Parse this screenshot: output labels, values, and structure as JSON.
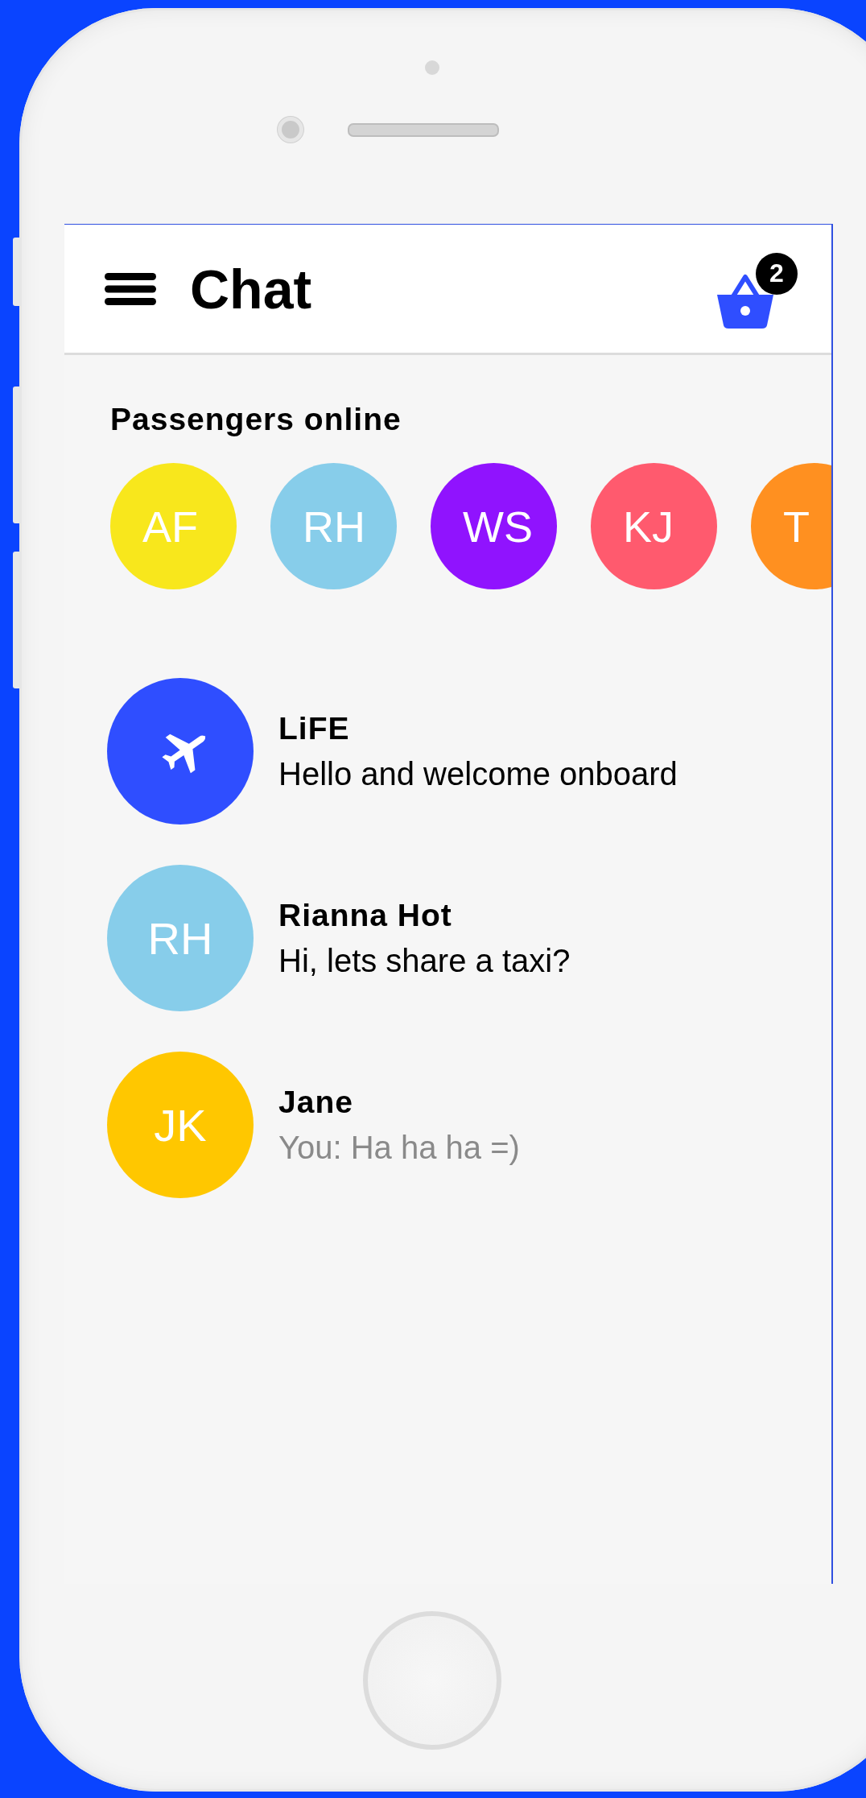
{
  "header": {
    "title": "Chat",
    "cart_count": "2"
  },
  "passengers_title": "Passengers online",
  "passengers": [
    {
      "initials": "AF",
      "color": "#f8e71c"
    },
    {
      "initials": "RH",
      "color": "#87cdea"
    },
    {
      "initials": "WS",
      "color": "#9013fe"
    },
    {
      "initials": "KJ",
      "color": "#ff5a6e"
    },
    {
      "initials": "T",
      "color": "#ff9020"
    }
  ],
  "chats": [
    {
      "kind": "icon",
      "color": "#2f4eff",
      "name": "LiFE",
      "message": "Hello and welcome onboard",
      "from_me": false
    },
    {
      "kind": "initials",
      "initials": "RH",
      "color": "#87cdea",
      "name": "Rianna Hot",
      "message": "Hi, lets share a taxi?",
      "from_me": false
    },
    {
      "kind": "initials",
      "initials": "JK",
      "color": "#ffc700",
      "name": "Jane",
      "message": "You: Ha ha ha =)",
      "from_me": true
    }
  ]
}
